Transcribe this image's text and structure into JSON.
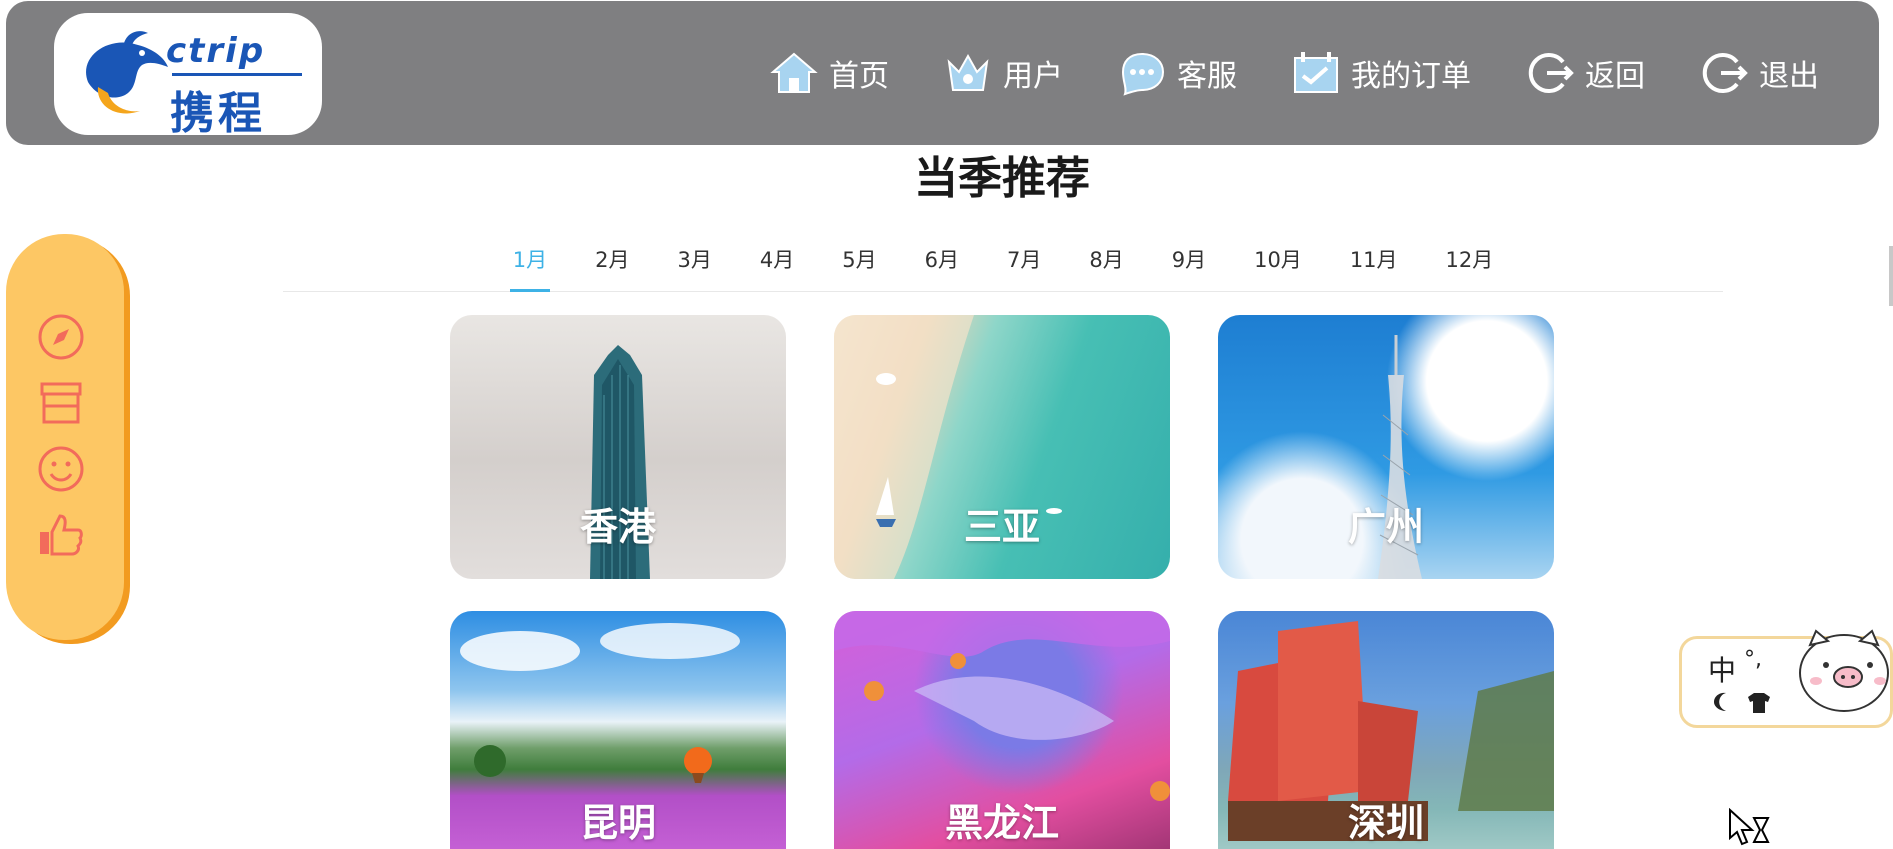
{
  "header": {
    "logo": {
      "brand_en": "ctrip",
      "brand_cn": "携程"
    },
    "nav": [
      {
        "label": "首页",
        "icon": "home-icon"
      },
      {
        "label": "用户",
        "icon": "user-crown-icon"
      },
      {
        "label": "客服",
        "icon": "chat-bubble-icon"
      },
      {
        "label": "我的订单",
        "icon": "calendar-check-icon"
      },
      {
        "label": "返回",
        "icon": "logout-arrow-icon"
      },
      {
        "label": "退出",
        "icon": "logout-arrow-icon"
      }
    ]
  },
  "section": {
    "title": "当季推荐",
    "months": [
      "1月",
      "2月",
      "3月",
      "4月",
      "5月",
      "6月",
      "7月",
      "8月",
      "9月",
      "10月",
      "11月",
      "12月"
    ],
    "active_month": "1月"
  },
  "destinations": [
    {
      "name": "香港"
    },
    {
      "name": "三亚"
    },
    {
      "name": "广州"
    },
    {
      "name": "昆明"
    },
    {
      "name": "黑龙江"
    },
    {
      "name": "深圳"
    }
  ],
  "sidebar": {
    "icons": [
      "compass-icon",
      "store-icon",
      "smile-icon",
      "thumbs-up-icon"
    ]
  },
  "ime": {
    "mode": "中",
    "punct": "°,"
  },
  "colors": {
    "nav_bg": "#7f7f81",
    "tab_active": "#3eb2e6",
    "sidebar_bg": "#fdc764",
    "sidebar_icon": "#f26b5b",
    "logo_blue": "#1a56b6"
  }
}
